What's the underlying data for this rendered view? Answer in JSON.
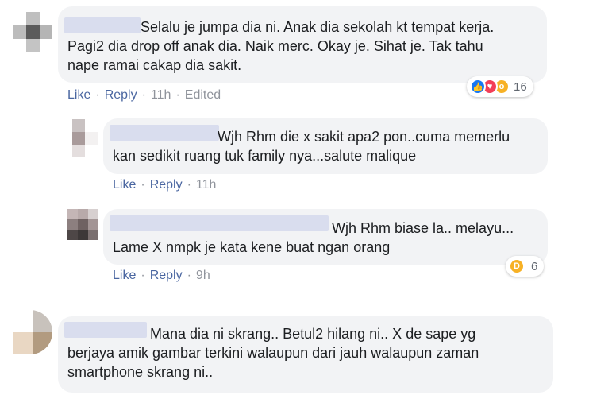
{
  "comments": [
    {
      "text": "Selalu je jumpa dia ni. Anak dia sekolah kt tempat kerja.\nPagi2 dia drop off anak dia. Naik merc. Okay je. Sihat je. Tak tahu\nnape ramai cakap dia sakit.",
      "like_label": "Like",
      "reply_label": "Reply",
      "time": "11h",
      "edited_label": "Edited",
      "reaction_count": "16"
    },
    {
      "text": "Wjh Rhm die x sakit apa2 pon..cuma memerlu\nkan sedikit ruang tuk family nya...salute malique",
      "like_label": "Like",
      "reply_label": "Reply",
      "time": "11h"
    },
    {
      "text": "Wjh Rhm biase la.. melayu...\nLame X nmpk je kata kene buat ngan orang",
      "like_label": "Like",
      "reply_label": "Reply",
      "time": "9h",
      "reaction_count": "6"
    },
    {
      "text": "Mana dia ni skrang.. Betul2 hilang ni.. X de sape yg\nberjaya amik gambar terkini walaupun dari jauh walaupun zaman\nsmartphone skrang ni.."
    }
  ],
  "colors": {
    "bubble": "#f2f3f5",
    "link": "#4b67a1",
    "meta": "#90949c",
    "name_blur": "#d9ddee"
  },
  "icons": {
    "like": "thumbs-up-icon",
    "love": "heart-icon",
    "wow": "wow-face-icon",
    "haha": "laughing-face-icon"
  }
}
